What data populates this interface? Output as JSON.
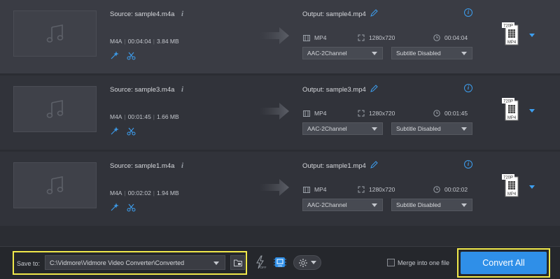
{
  "items": [
    {
      "source": "Source: sample4.m4a",
      "format": "M4A",
      "duration": "00:04:04",
      "size": "3.84 MB",
      "output": "Output: sample4.mp4",
      "out_format": "MP4",
      "resolution": "1280x720",
      "out_duration": "00:04:04",
      "audio": "AAC-2Channel",
      "subtitle": "Subtitle Disabled"
    },
    {
      "source": "Source: sample3.m4a",
      "format": "M4A",
      "duration": "00:01:45",
      "size": "1.66 MB",
      "output": "Output: sample3.mp4",
      "out_format": "MP4",
      "resolution": "1280x720",
      "out_duration": "00:01:45",
      "audio": "AAC-2Channel",
      "subtitle": "Subtitle Disabled"
    },
    {
      "source": "Source: sample1.m4a",
      "format": "M4A",
      "duration": "00:02:02",
      "size": "1.94 MB",
      "output": "Output: sample1.mp4",
      "out_format": "MP4",
      "resolution": "1280x720",
      "out_duration": "00:02:02",
      "audio": "AAC-2Channel",
      "subtitle": "Subtitle Disabled"
    }
  ],
  "format_badge": {
    "top": "720P",
    "bottom": "MP4"
  },
  "footer": {
    "save_to_label": "Save to:",
    "save_path": "C:\\Vidmore\\Vidmore Video Converter\\Converted",
    "hw_off": "OFF",
    "hw_on": "ON",
    "merge_label": "Merge into one file",
    "convert_label": "Convert All"
  },
  "colors": {
    "accent": "#2f8fe8",
    "highlight": "#f0e84a"
  }
}
